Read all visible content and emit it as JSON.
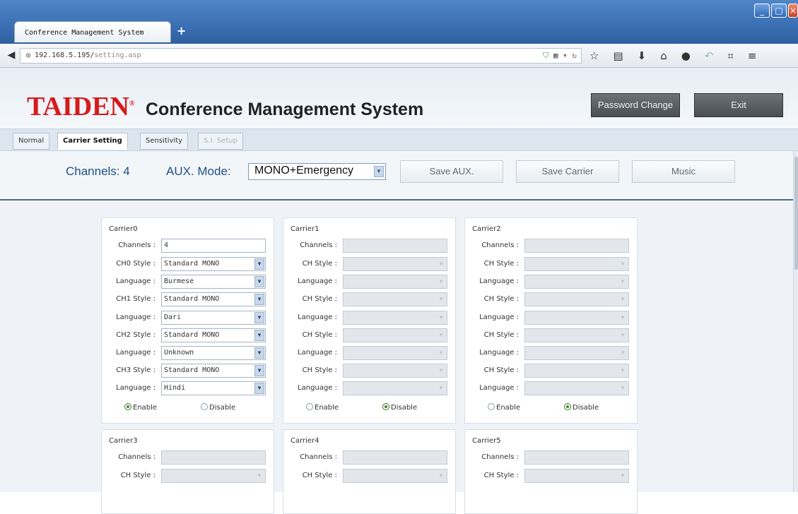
{
  "browser": {
    "tab_title": "Conference Management System",
    "new_tab": "+",
    "url_host": "192.168.5.195/",
    "url_path": "setting.asp"
  },
  "header": {
    "logo": "TAIDEN",
    "logo_mark": "®",
    "title": "Conference Management System",
    "password_button": "Password Change",
    "exit_button": "Exit"
  },
  "tabs": [
    {
      "label": "Normal",
      "state": "normal"
    },
    {
      "label": "Carrier Setting",
      "state": "active"
    },
    {
      "label": "Sensitivity",
      "state": "normal"
    },
    {
      "label": "S.I. Setup",
      "state": "disabled"
    }
  ],
  "toolbar": {
    "channels_label": "Channels: 4",
    "aux_label": "AUX. Mode:",
    "aux_value": "MONO+Emergency",
    "save_aux": "Save AUX.",
    "save_carrier": "Save Carrier",
    "music": "Music"
  },
  "carriers": [
    {
      "title": "Carrier0",
      "channels_label": "Channels :",
      "channels_value": "4",
      "rows": [
        {
          "label": "CH0 Style :",
          "value": "Standard MONO"
        },
        {
          "label": "Language :",
          "value": "Burmese"
        },
        {
          "label": "CH1 Style :",
          "value": "Standard MONO"
        },
        {
          "label": "Language :",
          "value": "Dari"
        },
        {
          "label": "CH2 Style :",
          "value": "Standard MONO"
        },
        {
          "label": "Language :",
          "value": "Unknown"
        },
        {
          "label": "CH3 Style :",
          "value": "Standard MONO"
        },
        {
          "label": "Language :",
          "value": "Hindi"
        }
      ],
      "enable": "Enable",
      "disable": "Disable",
      "selected": "Enable"
    },
    {
      "title": "Carrier1",
      "channels_label": "Channels :",
      "channels_value": "",
      "rows": [
        {
          "label": "CH Style :",
          "value": ""
        },
        {
          "label": "Language :",
          "value": ""
        },
        {
          "label": "CH Style :",
          "value": ""
        },
        {
          "label": "Language :",
          "value": ""
        },
        {
          "label": "CH Style :",
          "value": ""
        },
        {
          "label": "Language :",
          "value": ""
        },
        {
          "label": "CH Style :",
          "value": ""
        },
        {
          "label": "Language :",
          "value": ""
        }
      ],
      "enable": "Enable",
      "disable": "Disable",
      "selected": "Disable"
    },
    {
      "title": "Carrier2",
      "channels_label": "Channels :",
      "channels_value": "",
      "rows": [
        {
          "label": "CH Style :",
          "value": ""
        },
        {
          "label": "Language :",
          "value": ""
        },
        {
          "label": "CH Style :",
          "value": ""
        },
        {
          "label": "Language :",
          "value": ""
        },
        {
          "label": "CH Style :",
          "value": ""
        },
        {
          "label": "Language :",
          "value": ""
        },
        {
          "label": "CH Style :",
          "value": ""
        },
        {
          "label": "Language :",
          "value": ""
        }
      ],
      "enable": "Enable",
      "disable": "Disable",
      "selected": "Disable"
    },
    {
      "title": "Carrier3",
      "channels_label": "Channels :",
      "channels_value": "",
      "rows": [
        {
          "label": "CH Style :",
          "value": ""
        }
      ]
    },
    {
      "title": "Carrier4",
      "channels_label": "Channels :",
      "channels_value": "",
      "rows": [
        {
          "label": "CH Style :",
          "value": ""
        }
      ]
    },
    {
      "title": "Carrier5",
      "channels_label": "Channels :",
      "channels_value": "",
      "rows": [
        {
          "label": "CH Style :",
          "value": ""
        }
      ]
    }
  ]
}
